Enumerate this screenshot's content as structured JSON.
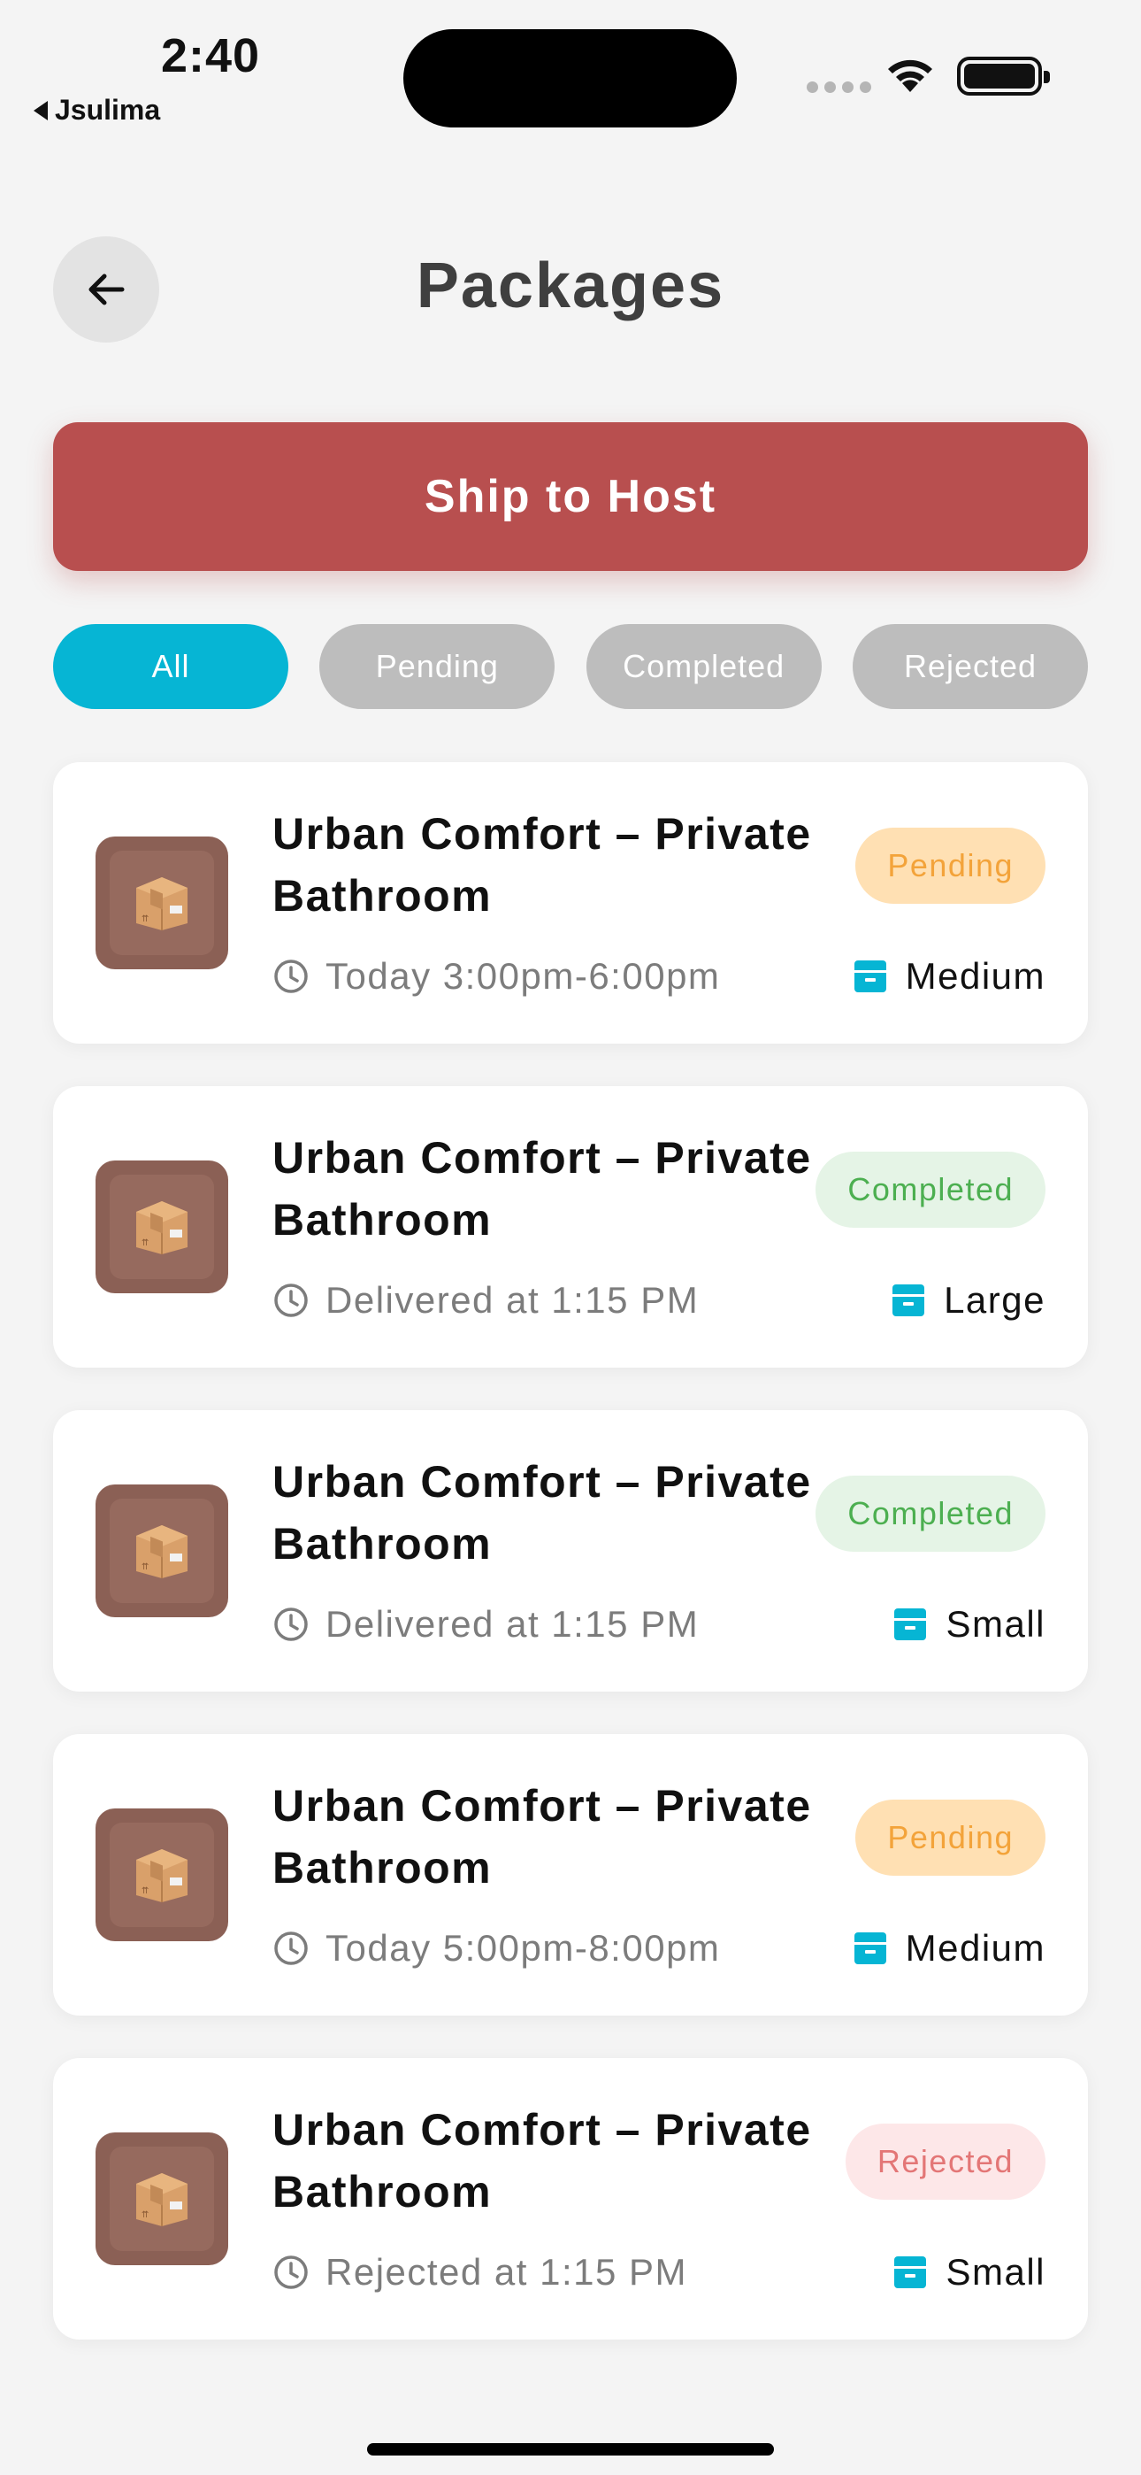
{
  "status_bar": {
    "time": "2:40",
    "back_app": "Jsulima"
  },
  "header": {
    "title": "Packages"
  },
  "ship_button": {
    "label": "Ship to Host"
  },
  "filters": [
    {
      "label": "All",
      "active": true
    },
    {
      "label": "Pending",
      "active": false
    },
    {
      "label": "Completed",
      "active": false
    },
    {
      "label": "Rejected",
      "active": false
    }
  ],
  "packages": [
    {
      "title": "Urban Comfort – Private Bathroom",
      "time": "Today 3:00pm-6:00pm",
      "status": "Pending",
      "size": "Medium"
    },
    {
      "title": "Urban Comfort – Private Bathroom",
      "time": "Delivered at 1:15 PM",
      "status": "Completed",
      "size": "Large"
    },
    {
      "title": "Urban Comfort – Private Bathroom",
      "time": "Delivered at 1:15 PM",
      "status": "Completed",
      "size": "Small"
    },
    {
      "title": "Urban Comfort – Private Bathroom",
      "time": "Today 5:00pm-8:00pm",
      "status": "Pending",
      "size": "Medium"
    },
    {
      "title": "Urban Comfort – Private Bathroom",
      "time": "Rejected at 1:15 PM",
      "status": "Rejected",
      "size": "Small"
    }
  ],
  "colors": {
    "primary_red": "#b84f4f",
    "active_chip": "#06b5d4",
    "inactive_chip": "#bdbdbd",
    "pending": "#f3a33a",
    "completed": "#4caf50",
    "rejected": "#e37676",
    "size_icon": "#06b5d4"
  },
  "icons": {
    "back": "arrow-left-icon",
    "package": "cardboard-box-icon",
    "time": "clock-icon",
    "size": "archive-box-icon"
  }
}
